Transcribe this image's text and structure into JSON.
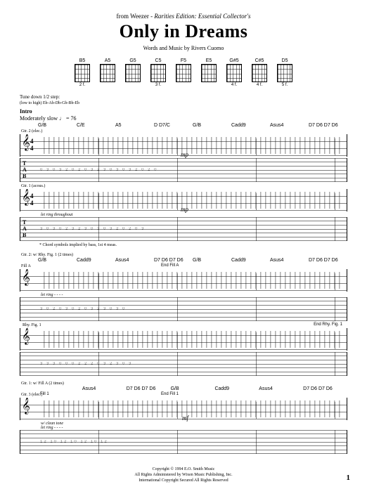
{
  "header": {
    "from_prefix": "from Weezer - ",
    "from_album": "Rarities Edition: Essential Collector's",
    "title": "Only in Dreams",
    "credit": "Words and Music by Rivers Cuomo"
  },
  "chord_diagrams": [
    {
      "name": "B5",
      "fret": "2 f."
    },
    {
      "name": "A5",
      "fret": ""
    },
    {
      "name": "G5",
      "fret": ""
    },
    {
      "name": "C5",
      "fret": "3 f."
    },
    {
      "name": "F5",
      "fret": ""
    },
    {
      "name": "E5",
      "fret": ""
    },
    {
      "name": "G#5",
      "fret": "4 f."
    },
    {
      "name": "C#5",
      "fret": "4 f."
    },
    {
      "name": "D5",
      "fret": "5 f."
    }
  ],
  "tuning": {
    "line1": "Tune down 1/2 step:",
    "line2": "(low to high) Eb-Ab-Db-Gb-Bb-Eb"
  },
  "intro": {
    "section": "Intro",
    "tempo": "Moderately slow ♩ = 76"
  },
  "system1": {
    "chords": [
      "G/B",
      "C/E",
      "A5",
      "D D7/C",
      "G/B",
      "Cadd9",
      "Asus4",
      "D7 D6 D7 D6"
    ],
    "gtr_label": "Gtr. 2 (elec.)",
    "dynamic": "mp",
    "gtr1_label": "Gtr. 1 (acous.)",
    "dynamic2": "mp",
    "perf_note": "let ring throughout",
    "footnote": "* Chord symbols implied by bass, 1st 4 meas."
  },
  "system2": {
    "gtr2_note": "Gtr. 2: w/ Rhy. Fig. 1 (2 times)",
    "chords": [
      "G/B",
      "Cadd9",
      "Asus4",
      "D7 D6 D7 D6",
      "G/B",
      "Cadd9",
      "Asus4",
      "D7 D6 D7 D6"
    ],
    "end_fill": "End Fill A",
    "fill_label": "Fill A",
    "perf_note": "let ring - - - -",
    "rhy_label": "Rhy. Fig. 1",
    "end_rhy": "End Rhy. Fig. 1"
  },
  "system3": {
    "gtr1_note": "Gtr. 1: w/ Fill A (2 times)",
    "chords": [
      "Asus4",
      "D7 D6 D7 D6",
      "G/B",
      "Cadd9",
      "Asus4",
      "D7 D6 D7 D6"
    ],
    "fill_label": "Fill 1",
    "end_fill": "End Fill 1",
    "gtr3_label": "Gtr. 3 (elec.)",
    "dynamic": "mf",
    "perf_note": "w/ clean tone",
    "perf_note2": "let ring - - - -"
  },
  "tab_labels": {
    "T": "T",
    "A": "A",
    "B": "B"
  },
  "timesig": {
    "top": "4",
    "bot": "4"
  },
  "copyright": {
    "line1": "Copyright © 1994 E.O. Smith Music",
    "line2": "All Rights Administered by Wixen Music Publishing, Inc.",
    "line3": "International Copyright Secured   All Rights Reserved"
  },
  "page_number": "1"
}
